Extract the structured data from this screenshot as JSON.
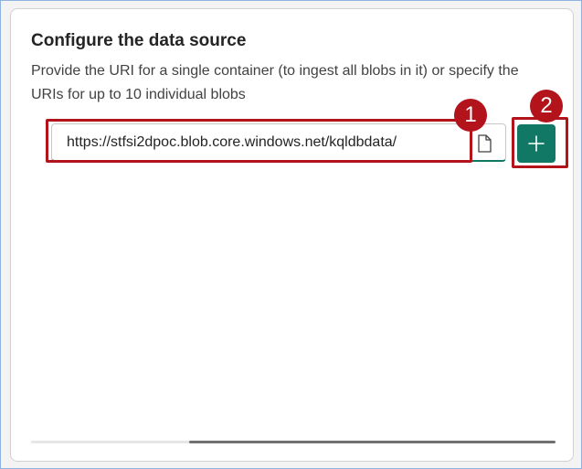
{
  "panel": {
    "title": "Configure the data source",
    "description": "Provide the URI for a single container (to ingest all blobs in it) or specify the URIs for up to 10 individual blobs"
  },
  "uri_input": {
    "value": "https://stfsi2dpoc.blob.core.windows.net/kqldbdata/",
    "icon": "document-icon"
  },
  "add_button": {
    "icon": "plus-icon",
    "color": "#117865"
  },
  "annotations": {
    "badge_1": "1",
    "badge_2": "2",
    "color": "#b3131b"
  },
  "scrollbar": {
    "position": 0.3
  }
}
